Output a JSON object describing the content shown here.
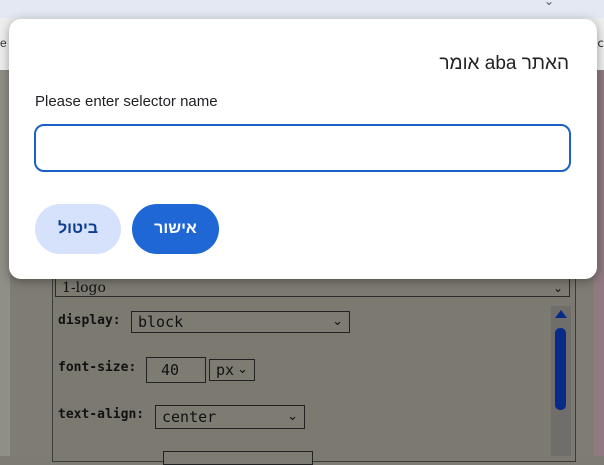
{
  "dialog": {
    "title": "האתר aba אומר",
    "prompt_label": "Please enter selector name",
    "input_value": "",
    "cancel_label": "ביטול",
    "ok_label": "אישור"
  },
  "background": {
    "selector_value": "1-logo",
    "properties": [
      {
        "label": "display:",
        "value": "block"
      },
      {
        "label": "font-size:",
        "value": "40",
        "unit": "px"
      },
      {
        "label": "text-align:",
        "value": "center"
      }
    ]
  },
  "colors": {
    "primary": "#1f67d4",
    "cancel_bg": "#d6e2fb",
    "input_border": "#1a5fc4"
  }
}
